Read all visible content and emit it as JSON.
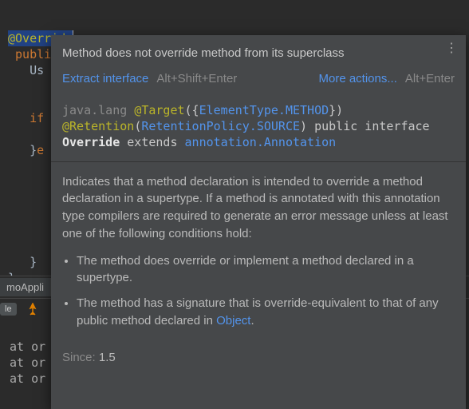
{
  "editor": {
    "line1_annotation": "@Override",
    "line2_kw": "public",
    "line3_indent_text": "Us",
    "line_if": "if",
    "line_brace_else_start": "}",
    "line_brace_else_kw": "e",
    "closing_brace1": "}",
    "closing_brace2": "}"
  },
  "popup": {
    "title": "Method does not override method from its superclass",
    "action1_label": "Extract interface",
    "action1_shortcut": "Alt+Shift+Enter",
    "action2_label": "More actions...",
    "action2_shortcut": "Alt+Enter",
    "code": {
      "package": "java.lang",
      "target_annot": "@Target",
      "target_arg": "ElementType.METHOD",
      "retention_annot": "@Retention",
      "retention_arg": "RetentionPolicy.SOURCE",
      "decl_kw": "public interface",
      "decl_name": "Override",
      "extends_kw": "extends",
      "extends_type": "annotation.Annotation"
    },
    "doc_p1": "Indicates that a method declaration is intended to override a method declaration in a supertype. If a method is annotated with this annotation type compilers are required to generate an error message unless at least one of the following conditions hold:",
    "doc_li1": "The method does override or implement a method declared in a supertype.",
    "doc_li2_pre": "The method has a signature that is override-equivalent to that of any public method declared in ",
    "doc_li2_link": "Object",
    "doc_li2_post": ".",
    "since_label": "Since:",
    "since_value": "1.5"
  },
  "bottom": {
    "tab_label": "moAppli",
    "pill_label": "le",
    "console_line1": "at or",
    "console_line2": "at or",
    "console_line3": "at or"
  }
}
